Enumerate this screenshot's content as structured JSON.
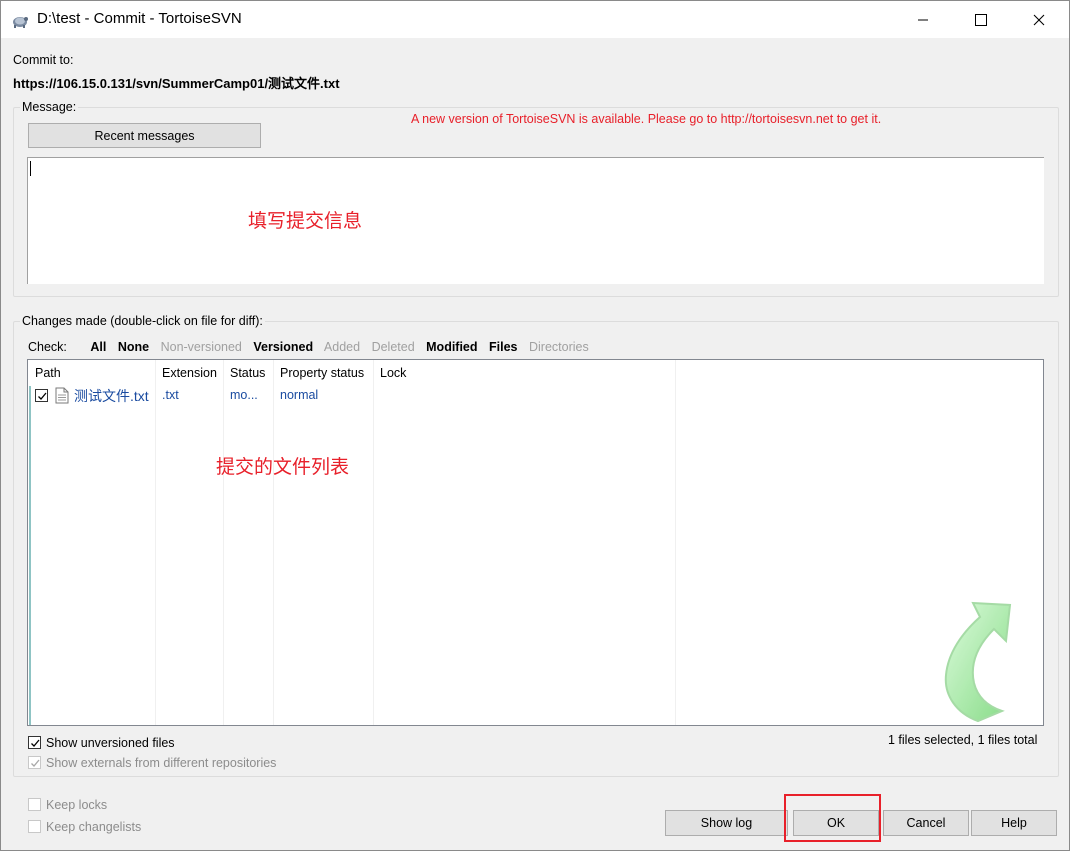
{
  "window": {
    "title": "D:\\test - Commit - TortoiseSVN"
  },
  "commit_to": {
    "label": "Commit to:",
    "url": "https://106.15.0.131/svn/SummerCamp01/测试文件.txt"
  },
  "message": {
    "group_label": "Message:",
    "recent_button": "Recent messages",
    "update_notice": "A new version of TortoiseSVN is available. Please go to http://tortoisesvn.net to get it.",
    "annotation": "填写提交信息",
    "value": ""
  },
  "changes": {
    "group_label": "Changes made (double-click on file for diff):",
    "check_label": "Check:",
    "filters": [
      {
        "label": "All",
        "enabled": true
      },
      {
        "label": "None",
        "enabled": true
      },
      {
        "label": "Non-versioned",
        "enabled": false
      },
      {
        "label": "Versioned",
        "enabled": true
      },
      {
        "label": "Added",
        "enabled": false
      },
      {
        "label": "Deleted",
        "enabled": false
      },
      {
        "label": "Modified",
        "enabled": true
      },
      {
        "label": "Files",
        "enabled": true
      },
      {
        "label": "Directories",
        "enabled": false
      }
    ],
    "columns": [
      "Path",
      "Extension",
      "Status",
      "Property status",
      "Lock"
    ],
    "rows": [
      {
        "checked": true,
        "path": "测试文件.txt",
        "extension": ".txt",
        "status": "mo...",
        "property_status": "normal",
        "lock": ""
      }
    ],
    "annotation": "提交的文件列表",
    "summary": "1 files selected, 1 files total"
  },
  "options": {
    "show_unversioned": "Show unversioned files",
    "show_externals": "Show externals from different repositories",
    "keep_locks": "Keep locks",
    "keep_changelists": "Keep changelists"
  },
  "buttons": {
    "show_log": "Show log",
    "ok": "OK",
    "cancel": "Cancel",
    "help": "Help"
  },
  "colors": {
    "highlight_red": "#e8202a",
    "link_blue": "#1a4ba0",
    "arrow_green": "#8ee88e"
  }
}
